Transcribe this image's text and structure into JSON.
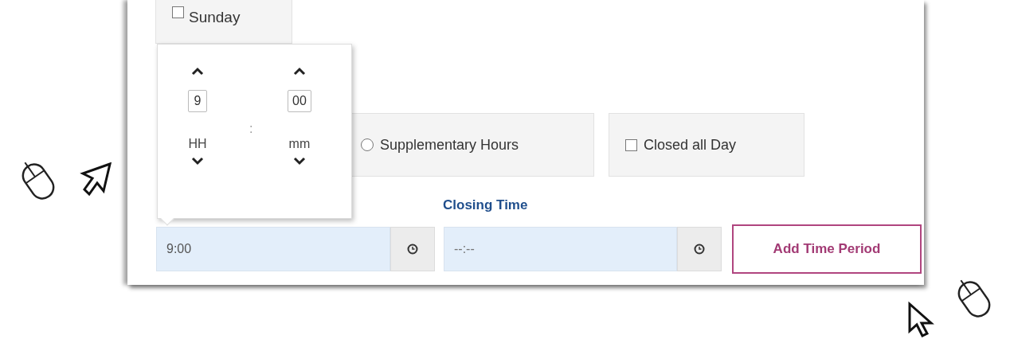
{
  "days": [
    {
      "label": "Sunday",
      "checked": false
    }
  ],
  "time_picker": {
    "hours": "9",
    "separator": ":",
    "minutes": "00",
    "hours_label": "HH",
    "minutes_label": "mm"
  },
  "options": [
    {
      "kind": "radio",
      "label": "Supplementary Hours",
      "selected": false
    },
    {
      "kind": "checkbox",
      "label": "Closed all Day",
      "checked": false
    }
  ],
  "opening_time": {
    "value": "9:00"
  },
  "closing_time": {
    "label": "Closing Time",
    "placeholder": "--:--"
  },
  "add_button": "Add Time Period"
}
